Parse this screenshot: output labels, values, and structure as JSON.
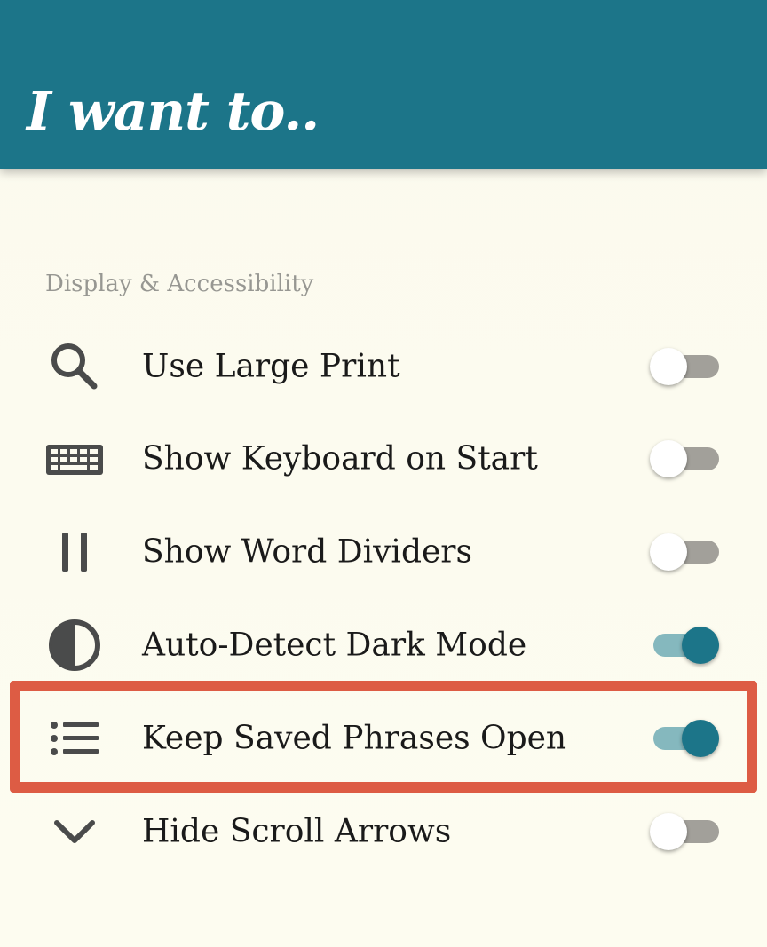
{
  "colors": {
    "accent": "#1c7589",
    "highlight": "#dd5c44",
    "icon": "#4a4b4b"
  },
  "header": {
    "title": "I want to.."
  },
  "section": {
    "title": "Display & Accessibility"
  },
  "settings": [
    {
      "label": "Use Large Print",
      "icon": "search-icon",
      "enabled": false
    },
    {
      "label": "Show Keyboard on Start",
      "icon": "keyboard-icon",
      "enabled": false
    },
    {
      "label": "Show Word Dividers",
      "icon": "pause-bars-icon",
      "enabled": false
    },
    {
      "label": "Auto-Detect Dark Mode",
      "icon": "contrast-icon",
      "enabled": true
    },
    {
      "label": "Keep Saved Phrases Open",
      "icon": "list-icon",
      "enabled": true,
      "highlighted": true
    },
    {
      "label": "Hide Scroll Arrows",
      "icon": "chevron-down-icon",
      "enabled": false
    }
  ]
}
